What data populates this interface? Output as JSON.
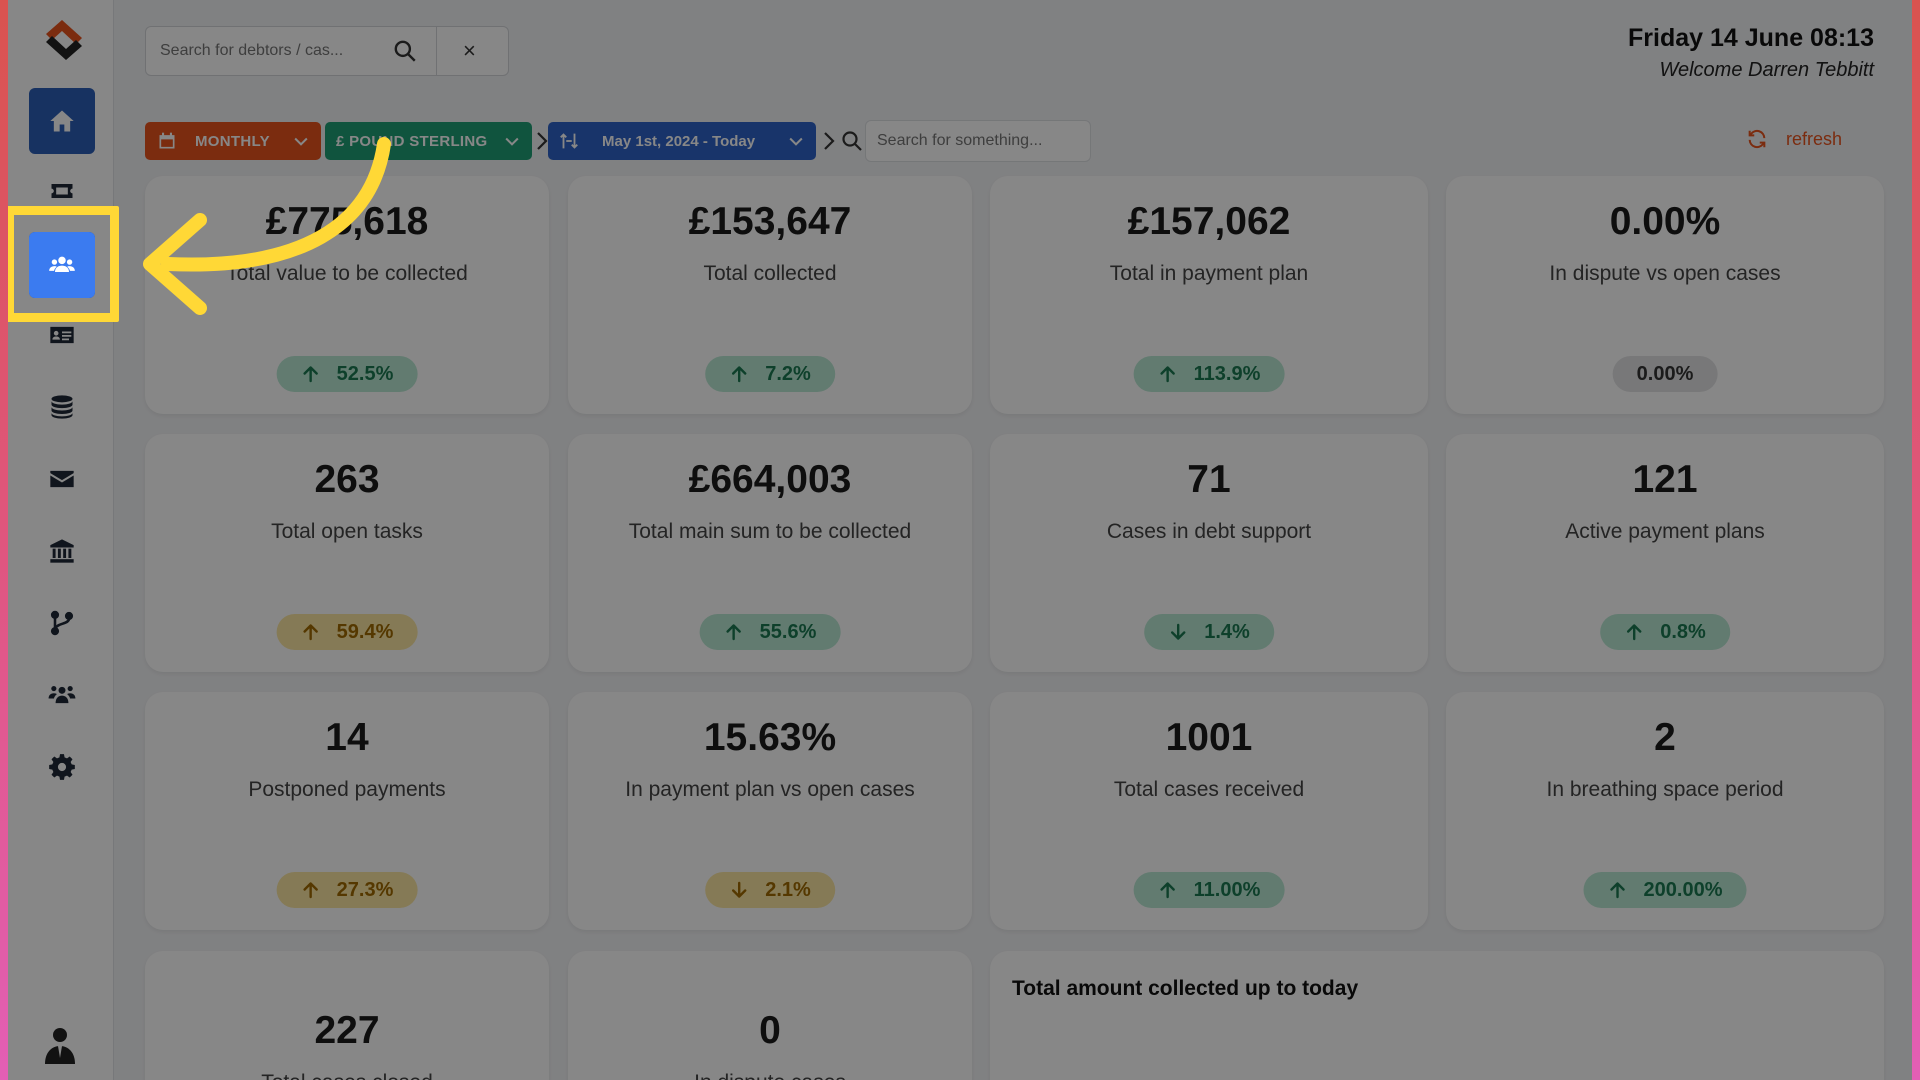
{
  "header": {
    "search_placeholder": "Search for debtors / cas...",
    "clear_label": "×",
    "date_title": "Friday 14 June 08:13",
    "welcome": "Welcome Darren Tebbitt"
  },
  "filters": {
    "period": "MONTHLY",
    "currency": "£ POUND STERLING",
    "range": "May 1st, 2024 - Today",
    "search_placeholder": "Search for something...",
    "refresh_label": "refresh"
  },
  "sidebar": {
    "items": [
      {
        "name": "home",
        "icon": "home-icon"
      },
      {
        "name": "cases",
        "icon": "ticket-icon"
      },
      {
        "name": "debtors",
        "icon": "users-icon",
        "active": true
      },
      {
        "name": "contacts",
        "icon": "id-card-icon"
      },
      {
        "name": "database",
        "icon": "database-icon"
      },
      {
        "name": "mail",
        "icon": "envelope-icon"
      },
      {
        "name": "bank",
        "icon": "bank-icon"
      },
      {
        "name": "workflows",
        "icon": "branch-icon"
      },
      {
        "name": "team",
        "icon": "user-group-icon"
      },
      {
        "name": "settings",
        "icon": "gear-icon"
      }
    ]
  },
  "cards": [
    {
      "value": "£775,618",
      "label": "Total value to be collected",
      "badge": "52.5%",
      "trend": "up",
      "tone": "green"
    },
    {
      "value": "£153,647",
      "label": "Total collected",
      "badge": "7.2%",
      "trend": "up",
      "tone": "green"
    },
    {
      "value": "£157,062",
      "label": "Total in payment plan",
      "badge": "113.9%",
      "trend": "up",
      "tone": "green"
    },
    {
      "value": "0.00%",
      "label": "In dispute vs open cases",
      "badge": "0.00%",
      "trend": "none",
      "tone": "gray"
    },
    {
      "value": "263",
      "label": "Total open tasks",
      "badge": "59.4%",
      "trend": "up",
      "tone": "yellow"
    },
    {
      "value": "£664,003",
      "label": "Total main sum to be collected",
      "badge": "55.6%",
      "trend": "up",
      "tone": "green"
    },
    {
      "value": "71",
      "label": "Cases in debt support",
      "badge": "1.4%",
      "trend": "down",
      "tone": "green"
    },
    {
      "value": "121",
      "label": "Active payment plans",
      "badge": "0.8%",
      "trend": "up",
      "tone": "green"
    },
    {
      "value": "14",
      "label": "Postponed payments",
      "badge": "27.3%",
      "trend": "up",
      "tone": "yellow"
    },
    {
      "value": "15.63%",
      "label": "In payment plan vs open cases",
      "badge": "2.1%",
      "trend": "down",
      "tone": "yellow"
    },
    {
      "value": "1001",
      "label": "Total cases received",
      "badge": "11.00%",
      "trend": "up",
      "tone": "green"
    },
    {
      "value": "2",
      "label": "In breathing space period",
      "badge": "200.00%",
      "trend": "up",
      "tone": "green"
    },
    {
      "value": "227",
      "label": "Total cases closed",
      "badge": "",
      "trend": "none",
      "tone": "none"
    },
    {
      "value": "0",
      "label": "In dispute cases",
      "badge": "",
      "trend": "none",
      "tone": "none"
    }
  ],
  "chart_panel": {
    "title": "Total amount collected up to today"
  },
  "colors": {
    "accent_orange": "#e9541e",
    "accent_green": "#1f9f76",
    "accent_blue": "#2e63c8",
    "highlight_yellow": "#ffd836"
  }
}
